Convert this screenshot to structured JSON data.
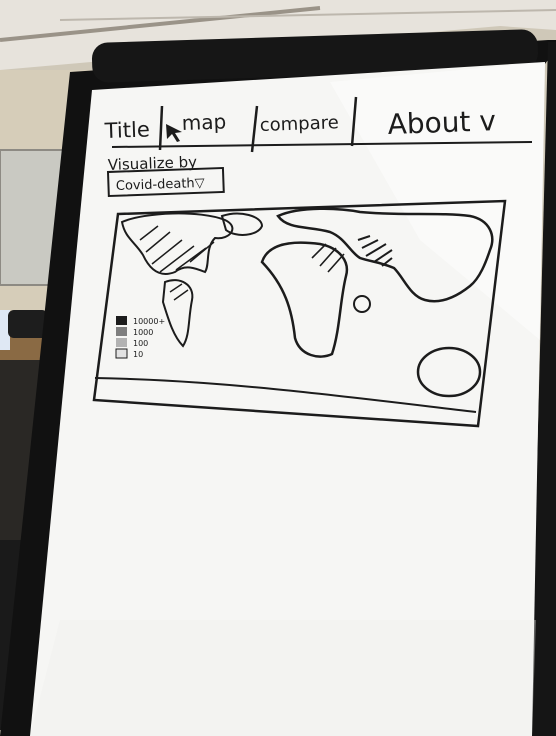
{
  "whiteboard": {
    "nav": {
      "title": "Title",
      "map": "map",
      "compare": "compare",
      "about": "About v"
    },
    "visualize_label": "Visualize by",
    "dropdown_value": "Covid-death▽",
    "legend": {
      "items": [
        "10000+",
        "1000",
        "100",
        "10"
      ]
    }
  },
  "colors": {
    "ink": "#1c1c1c",
    "board": "#f6f6f4",
    "frame": "#141414",
    "wall": "#cfc8b8"
  }
}
